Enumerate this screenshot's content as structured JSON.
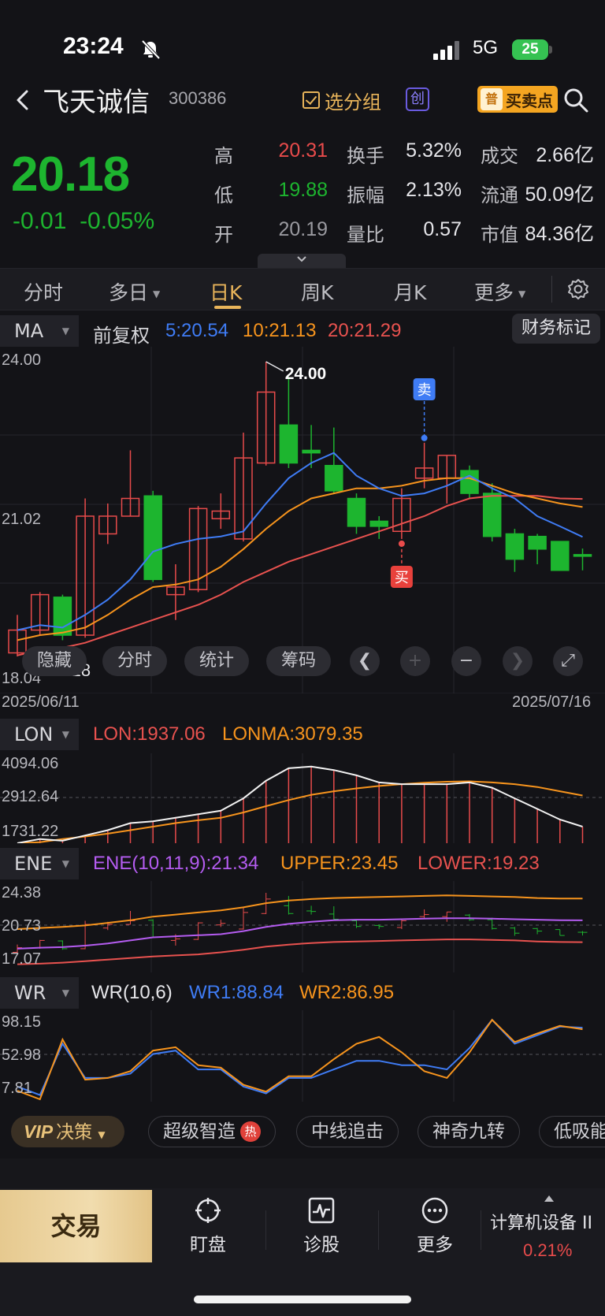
{
  "status_bar": {
    "time": "23:24",
    "network": "5G",
    "battery": "25"
  },
  "header": {
    "stock_name": "飞天诚信",
    "stock_code": "300386",
    "group_button": "选分组",
    "chuang_badge": "创",
    "buysell_icon": "普",
    "buysell_label": "买卖点"
  },
  "quote": {
    "price": "20.18",
    "change": "-0.01",
    "change_pct": "-0.05%",
    "stats": [
      {
        "label": "高",
        "value": "20.31",
        "color": "#e84b4b"
      },
      {
        "label": "低",
        "value": "19.88",
        "color": "#1db52f"
      },
      {
        "label": "开",
        "value": "20.19",
        "color": "#9a9aa0"
      },
      {
        "label": "换手",
        "value": "5.32%",
        "color": "#e6e6ea"
      },
      {
        "label": "振幅",
        "value": "2.13%",
        "color": "#e6e6ea"
      },
      {
        "label": "量比",
        "value": "0.57",
        "color": "#e6e6ea"
      },
      {
        "label": "成交",
        "value": "2.66亿",
        "color": "#e6e6ea"
      },
      {
        "label": "流通",
        "value": "50.09亿",
        "color": "#e6e6ea"
      },
      {
        "label": "市值",
        "value": "84.36亿",
        "color": "#e6e6ea"
      }
    ]
  },
  "tabs": [
    {
      "label": "分时"
    },
    {
      "label": "多日",
      "caret": "▼"
    },
    {
      "label": "日K",
      "active": true
    },
    {
      "label": "周K"
    },
    {
      "label": "月K"
    },
    {
      "label": "更多",
      "caret": "▼"
    }
  ],
  "ma": {
    "tag": "MA",
    "adjust": "前复权",
    "ma5": "5:20.54",
    "ma10": "10:21.13",
    "ma20": "20:21.29",
    "finance_button": "财务标记",
    "y_top": "24.00",
    "y_mid": "21.02",
    "y_bottom": "18.04",
    "high_label": "24.00",
    "low_label": "18.18",
    "sell_tag": "卖",
    "buy_tag": "买",
    "date_start": "2025/06/11",
    "date_end": "2025/07/16",
    "overlay_buttons": [
      "隐藏",
      "分时",
      "统计",
      "筹码"
    ]
  },
  "lon": {
    "tag": "LON",
    "lon": "LON:1937.06",
    "lonma": "LONMA:3079.35",
    "y_top": "4094.06",
    "y_mid": "2912.64",
    "y_bottom": "1731.22"
  },
  "ene": {
    "tag": "ENE",
    "ene": "ENE(10,11,9):21.34",
    "upper": "UPPER:23.45",
    "lower": "LOWER:19.23",
    "y_top": "24.38",
    "y_mid": "20.73",
    "y_bottom": "17.07"
  },
  "wr": {
    "tag": "WR",
    "params": "WR(10,6)",
    "wr1": "WR1:88.84",
    "wr2": "WR2:86.95",
    "y_top": "98.15",
    "y_mid": "52.98",
    "y_bottom": "7.81"
  },
  "chart_data": {
    "type": "candlestick",
    "x_range": [
      "2025/06/11",
      "2025/07/16"
    ],
    "ylim": [
      18.04,
      24.0
    ],
    "candles": [
      {
        "open": 18.25,
        "close": 18.7,
        "high": 19.0,
        "low": 18.18
      },
      {
        "open": 18.7,
        "close": 19.4,
        "high": 19.45,
        "low": 18.6
      },
      {
        "open": 19.35,
        "close": 18.6,
        "high": 19.4,
        "low": 18.5
      },
      {
        "open": 18.6,
        "close": 20.95,
        "high": 21.3,
        "low": 18.55
      },
      {
        "open": 20.6,
        "close": 20.95,
        "high": 21.2,
        "low": 20.4
      },
      {
        "open": 20.95,
        "close": 21.3,
        "high": 22.25,
        "low": 20.95
      },
      {
        "open": 21.35,
        "close": 19.7,
        "high": 21.45,
        "low": 19.65
      },
      {
        "open": 19.4,
        "close": 19.55,
        "high": 20.0,
        "low": 18.9
      },
      {
        "open": 19.5,
        "close": 21.1,
        "high": 21.15,
        "low": 19.45
      },
      {
        "open": 20.9,
        "close": 21.05,
        "high": 21.4,
        "low": 20.7
      },
      {
        "open": 20.5,
        "close": 22.1,
        "high": 22.6,
        "low": 20.45
      },
      {
        "open": 22.0,
        "close": 23.4,
        "high": 24.0,
        "low": 21.95
      },
      {
        "open": 22.75,
        "close": 22.0,
        "high": 23.7,
        "low": 21.9
      },
      {
        "open": 22.25,
        "close": 22.2,
        "high": 22.75,
        "low": 21.9
      },
      {
        "open": 21.95,
        "close": 21.45,
        "high": 22.7,
        "low": 21.4
      },
      {
        "open": 21.3,
        "close": 20.75,
        "high": 21.4,
        "low": 20.6
      },
      {
        "open": 20.85,
        "close": 20.75,
        "high": 20.95,
        "low": 20.5
      },
      {
        "open": 20.65,
        "close": 21.3,
        "high": 21.5,
        "low": 20.5
      },
      {
        "open": 21.7,
        "close": 21.9,
        "high": 22.4,
        "low": 21.5
      },
      {
        "open": 21.7,
        "close": 22.15,
        "high": 22.15,
        "low": 21.2
      },
      {
        "open": 21.85,
        "close": 21.4,
        "high": 21.95,
        "low": 21.3
      },
      {
        "open": 21.4,
        "close": 20.55,
        "high": 21.6,
        "low": 20.45
      },
      {
        "open": 20.6,
        "close": 20.1,
        "high": 20.7,
        "low": 19.85
      },
      {
        "open": 20.55,
        "close": 20.3,
        "high": 20.6,
        "low": 20.0
      },
      {
        "open": 20.45,
        "close": 19.88,
        "high": 20.45,
        "low": 19.88
      },
      {
        "open": 20.19,
        "close": 20.18,
        "high": 20.31,
        "low": 19.88
      }
    ],
    "ma5": [
      18.7,
      18.8,
      18.75,
      19.0,
      19.3,
      19.7,
      20.25,
      20.4,
      20.5,
      20.55,
      20.65,
      21.2,
      21.7,
      22.0,
      22.2,
      21.75,
      21.5,
      21.35,
      21.4,
      21.55,
      21.75,
      21.5,
      21.3,
      20.95,
      20.75,
      20.54
    ],
    "ma10": [
      18.5,
      18.6,
      18.65,
      18.75,
      19.0,
      19.3,
      19.55,
      19.6,
      19.7,
      19.95,
      20.3,
      20.7,
      21.05,
      21.3,
      21.4,
      21.5,
      21.5,
      21.55,
      21.65,
      21.7,
      21.7,
      21.55,
      21.4,
      21.3,
      21.2,
      21.13
    ],
    "ma20": [
      18.2,
      18.3,
      18.35,
      18.45,
      18.6,
      18.75,
      18.9,
      19.05,
      19.2,
      19.4,
      19.65,
      19.85,
      20.05,
      20.2,
      20.35,
      20.5,
      20.65,
      20.8,
      20.95,
      21.15,
      21.3,
      21.35,
      21.35,
      21.35,
      21.3,
      21.29
    ],
    "buy_index": 17,
    "sell_index": 18
  },
  "lon_data": {
    "ylim": [
      1731.22,
      4094.06
    ],
    "lon": [
      1731,
      1850,
      1800,
      1950,
      2100,
      2300,
      2350,
      2450,
      2550,
      2650,
      3000,
      3500,
      3850,
      3900,
      3800,
      3650,
      3450,
      3400,
      3400,
      3400,
      3450,
      3300,
      3000,
      2700,
      2400,
      2200
    ],
    "lonma": [
      1731,
      1760,
      1850,
      1920,
      2000,
      2100,
      2200,
      2300,
      2380,
      2450,
      2600,
      2780,
      2950,
      3100,
      3200,
      3280,
      3350,
      3400,
      3440,
      3470,
      3480,
      3450,
      3400,
      3320,
      3200,
      3079
    ]
  },
  "ene_data": {
    "ylim": [
      17.07,
      24.38
    ],
    "ene": [
      18.6,
      18.7,
      18.75,
      18.9,
      19.1,
      19.4,
      19.7,
      19.8,
      19.9,
      20.0,
      20.3,
      20.7,
      21.0,
      21.2,
      21.35,
      21.4,
      21.4,
      21.45,
      21.5,
      21.55,
      21.55,
      21.5,
      21.45,
      21.4,
      21.35,
      21.34
    ],
    "upper": [
      20.5,
      20.6,
      20.7,
      20.85,
      21.1,
      21.35,
      21.7,
      21.9,
      22.1,
      22.3,
      22.6,
      23.0,
      23.25,
      23.4,
      23.5,
      23.55,
      23.6,
      23.65,
      23.7,
      23.75,
      23.7,
      23.65,
      23.6,
      23.5,
      23.45,
      23.45
    ],
    "lower": [
      17.1,
      17.15,
      17.25,
      17.4,
      17.55,
      17.7,
      17.85,
      17.95,
      18.05,
      18.25,
      18.5,
      18.8,
      19.0,
      19.15,
      19.25,
      19.3,
      19.35,
      19.4,
      19.45,
      19.5,
      19.5,
      19.45,
      19.4,
      19.3,
      19.25,
      19.23
    ]
  },
  "wr_data": {
    "ylim": [
      7.81,
      98.15
    ],
    "wr1": [
      20,
      10,
      70,
      30,
      30,
      35,
      58,
      62,
      40,
      40,
      20,
      12,
      30,
      30,
      40,
      50,
      50,
      45,
      45,
      40,
      65,
      98,
      70,
      80,
      90,
      88.84
    ],
    "wr2": [
      15,
      5,
      75,
      28,
      30,
      38,
      62,
      66,
      45,
      42,
      22,
      14,
      32,
      32,
      52,
      70,
      78,
      60,
      38,
      30,
      60,
      98,
      72,
      82,
      91,
      86.95
    ]
  },
  "decision": {
    "vip": "VIP",
    "vip_label": "决策",
    "chips": [
      "超级智造",
      "中线追击",
      "神奇九转",
      "低吸能"
    ],
    "hot": "热"
  },
  "bottom_nav": {
    "trade": "交易",
    "items": [
      "盯盘",
      "诊股",
      "更多"
    ],
    "sector_name": "计算机设备 II",
    "sector_pct": "0.21%"
  },
  "colors": {
    "up": "#e84b4b",
    "down": "#1db52f",
    "ma5": "#3f7cf5",
    "ma10": "#f7941d",
    "ma20": "#e8524f",
    "purple": "#b45cf0",
    "accent": "#e8b45a"
  }
}
